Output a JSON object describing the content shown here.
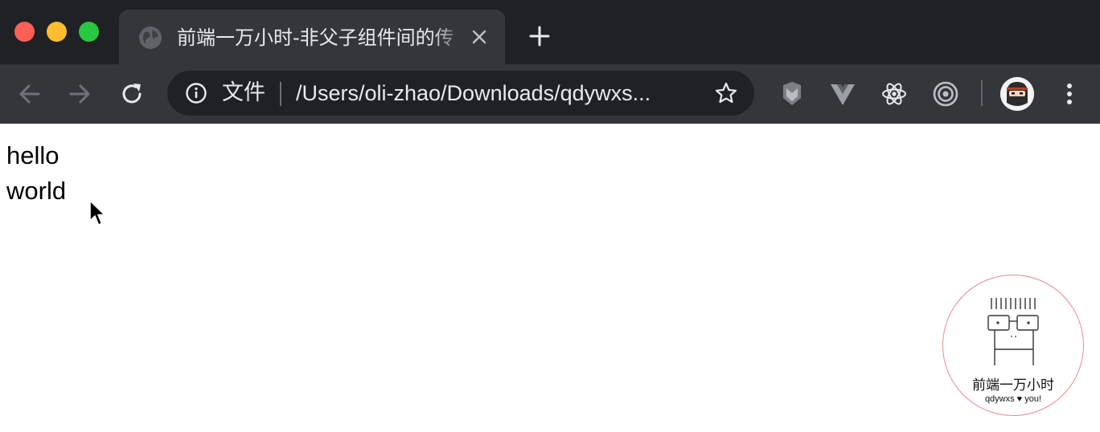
{
  "window": {
    "controls": [
      "close",
      "minimize",
      "zoom"
    ]
  },
  "tab": {
    "favicon": "globe-icon",
    "title": "前端一万小时-非父子组件间的传",
    "close_icon": "close-icon"
  },
  "new_tab_icon": "plus-icon",
  "toolbar": {
    "back_icon": "arrow-left-icon",
    "forward_icon": "arrow-right-icon",
    "reload_icon": "reload-icon",
    "omnibox": {
      "info_icon": "info-icon",
      "scheme_label": "文件",
      "url": "/Users/oli-zhao/Downloads/qdywxs...",
      "bookmark_icon": "star-icon"
    },
    "extensions": [
      "shield-extension-icon",
      "vue-devtools-icon",
      "react-devtools-icon",
      "target-extension-icon"
    ],
    "profile_icon": "avatar",
    "menu_icon": "kebab-menu-icon"
  },
  "page": {
    "lines": [
      "hello",
      "world"
    ]
  },
  "watermark": {
    "title": "前端一万小时",
    "subtitle": "qdywxs ♥ you!",
    "border_color": "#ec8a92"
  },
  "colors": {
    "tabstrip": "#202124",
    "toolbar": "#35363a",
    "omnibox": "#202124",
    "text": "#e8eaed"
  }
}
